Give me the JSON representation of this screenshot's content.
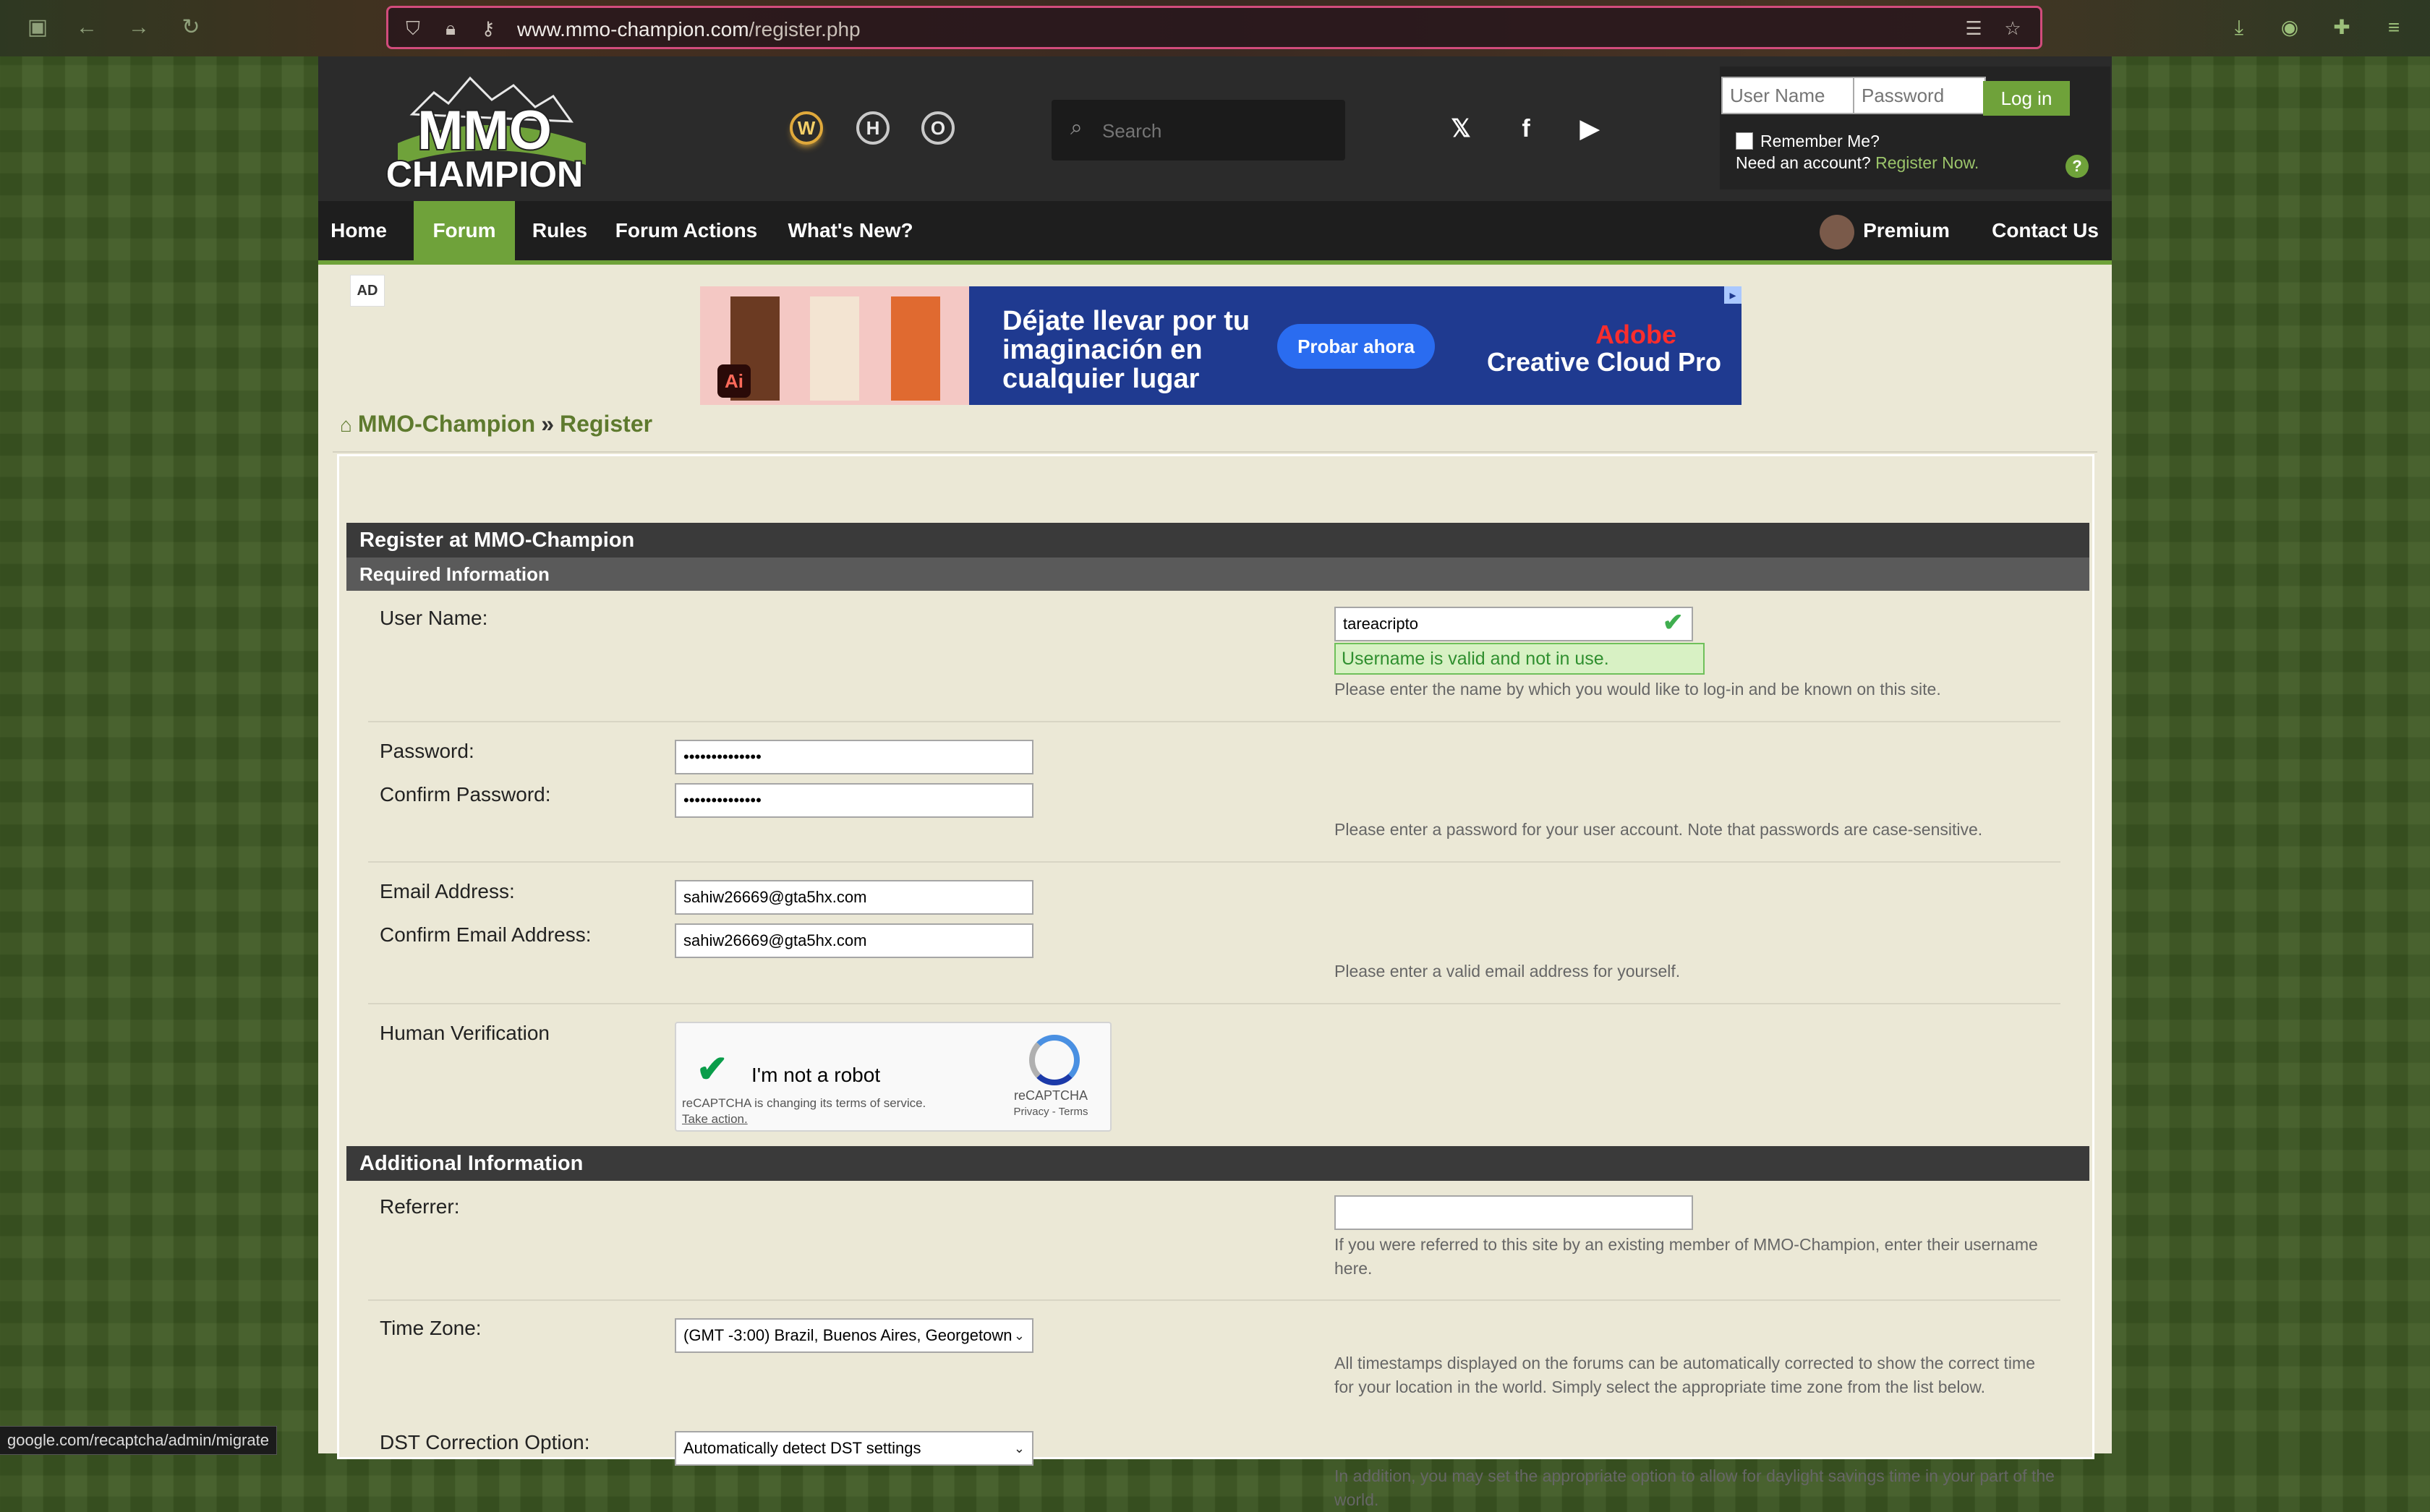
{
  "browser": {
    "url_host": "www.mmo-champion.com",
    "url_path": "/register.php",
    "status_url": "google.com/recaptcha/admin/migrate"
  },
  "header": {
    "logo_line1": "MMO",
    "logo_line2": "CHAMPION",
    "games": [
      "W",
      "H",
      "O"
    ],
    "search_placeholder": "Search",
    "login": {
      "username_placeholder": "User Name",
      "password_placeholder": "Password",
      "button": "Log in",
      "remember": "Remember Me?",
      "need_account": "Need an account?",
      "register_link": "Register Now.",
      "help": "?"
    }
  },
  "nav": {
    "items": [
      "Home",
      "Forum",
      "Rules",
      "Forum Actions",
      "What's New?"
    ],
    "premium": "Premium",
    "contact": "Contact Us"
  },
  "ad": {
    "label": "AD",
    "headline": "Déjate llevar por tu imaginación en cualquier lugar",
    "cta": "Probar ahora",
    "brand1": "Adobe",
    "brand2": "Creative Cloud Pro",
    "app_logo": "Ai"
  },
  "breadcrumb": {
    "site": "MMO-Champion",
    "sep": "»",
    "page": "Register"
  },
  "form": {
    "title": "Register at MMO-Champion",
    "required_heading": "Required Information",
    "username_label": "User Name:",
    "username_value": "tareacripto",
    "username_valid": "Username is valid and not in use.",
    "username_desc": "Please enter the name by which you would like to log-in and be known on this site.",
    "password_label": "Password:",
    "password_value": "••••••••••••••",
    "confirm_password_label": "Confirm Password:",
    "confirm_password_value": "••••••••••••••",
    "password_desc": "Please enter a password for your user account. Note that passwords are case-sensitive.",
    "email_label": "Email Address:",
    "email_value": "sahiw26669@gta5hx.com",
    "confirm_email_label": "Confirm Email Address:",
    "confirm_email_value": "sahiw26669@gta5hx.com",
    "email_desc": "Please enter a valid email address for yourself.",
    "human_label": "Human Verification",
    "recaptcha": {
      "text": "I'm not a robot",
      "notice": "reCAPTCHA is changing its terms of service.",
      "action": "Take action.",
      "brand": "reCAPTCHA",
      "links": "Privacy - Terms"
    },
    "additional_heading": "Additional Information",
    "referrer_label": "Referrer:",
    "referrer_value": "",
    "referrer_desc": "If you were referred to this site by an existing member of MMO-Champion, enter their username here.",
    "timezone_label": "Time Zone:",
    "timezone_value": "(GMT -3:00) Brazil, Buenos Aires, Georgetown",
    "timezone_desc": "All timestamps displayed on the forums can be automatically corrected to show the correct time for your location in the world. Simply select the appropriate time zone from the list below.",
    "dst_label": "DST Correction Option:",
    "dst_value": "Automatically detect DST settings",
    "dst_desc": "In addition, you may set the appropriate option to allow for daylight savings time in your part of the world."
  },
  "colors": {
    "accent": "#6fa23a",
    "header_bg": "#2b2b2b",
    "page_bg": "#ebe8d6"
  }
}
